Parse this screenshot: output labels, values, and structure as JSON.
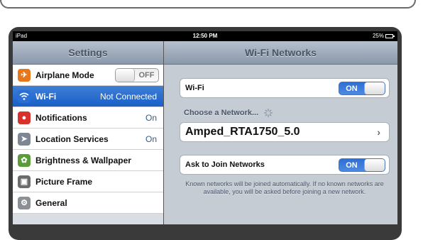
{
  "status": {
    "device": "iPad",
    "time": "12:50 PM",
    "battery": "25%"
  },
  "sidebar": {
    "title": "Settings",
    "items": [
      {
        "label": "Airplane Mode",
        "toggle": "OFF",
        "icon": "airplane-icon",
        "color": "#e8771b"
      },
      {
        "label": "Wi-Fi",
        "value": "Not Connected",
        "icon": "wifi-icon",
        "color": "#2b6fd6",
        "selected": true
      },
      {
        "label": "Notifications",
        "value": "On",
        "icon": "notifications-icon",
        "color": "#d8302a"
      },
      {
        "label": "Location Services",
        "value": "On",
        "icon": "location-icon",
        "color": "#7d8793"
      },
      {
        "label": "Brightness & Wallpaper",
        "icon": "brightness-icon",
        "color": "#5b9c3a"
      },
      {
        "label": "Picture Frame",
        "icon": "picture-frame-icon",
        "color": "#6b6b6b"
      },
      {
        "label": "General",
        "icon": "gear-icon",
        "color": "#8a9096"
      }
    ]
  },
  "detail": {
    "title": "Wi-Fi Networks",
    "wifi_label": "Wi-Fi",
    "wifi_toggle": "ON",
    "choose_label": "Choose a Network...",
    "network_name": "Amped_RTA1750_5.0",
    "ask_label": "Ask to Join Networks",
    "ask_toggle": "ON",
    "note": "Known networks will be joined automatically.  If no known networks are available, you will be asked before joining a new network."
  }
}
